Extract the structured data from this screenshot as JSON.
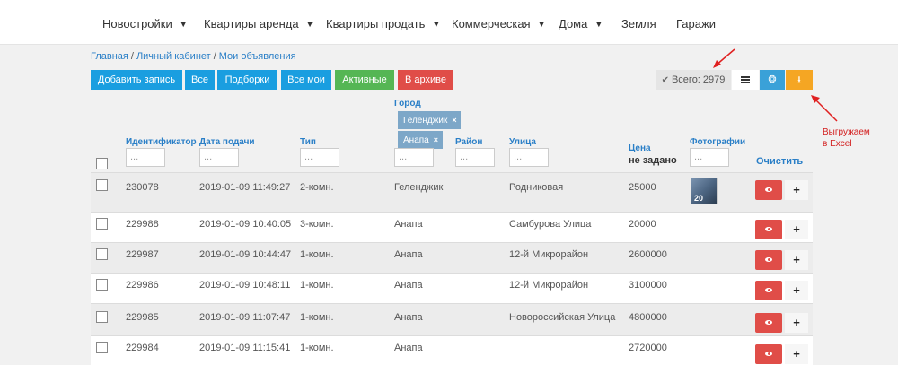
{
  "nav": [
    {
      "label": "Новостройки",
      "dropdown": true
    },
    {
      "label": "Квартиры аренда",
      "dropdown": true
    },
    {
      "label": "Квартиры продать",
      "dropdown": true
    },
    {
      "label": "Коммерческая",
      "dropdown": true
    },
    {
      "label": "Дома",
      "dropdown": true
    },
    {
      "label": "Земля",
      "dropdown": false
    },
    {
      "label": "Гаражи",
      "dropdown": false
    }
  ],
  "breadcrumb": [
    "Главная",
    "Личный кабинет",
    "Мои объявления"
  ],
  "toolbar": {
    "add": "Добавить запись",
    "all": "Все",
    "collections": "Подборки",
    "all_mine": "Все мои",
    "active": "Активные",
    "archive": "В архиве"
  },
  "total_label": "Всего: 2979",
  "annotation": [
    "Выгружаем",
    "в Excel"
  ],
  "filters": {
    "city_label": "Город",
    "city_chips": [
      "Геленджик",
      "Анапа"
    ],
    "id_label": "Идентификатор",
    "date_label": "Дата подачи",
    "type_label": "Тип",
    "district_label": "Район",
    "street_label": "Улица",
    "price_label": "Цена",
    "price_sort": "не задано",
    "photos_label": "Фотографии",
    "clear": "Очистить",
    "placeholder": "..."
  },
  "rows": [
    {
      "id": "230078",
      "date": "2019-01-09 11:49:27",
      "type": "2-комн.",
      "city": "Геленджик",
      "street": "Родниковая",
      "price": "25000",
      "photos": "20"
    },
    {
      "id": "229988",
      "date": "2019-01-09 10:40:05",
      "type": "3-комн.",
      "city": "Анапа",
      "street": "Самбурова Улица",
      "price": "20000",
      "photos": ""
    },
    {
      "id": "229987",
      "date": "2019-01-09 10:44:47",
      "type": "1-комн.",
      "city": "Анапа",
      "street": "12-й Микрорайон",
      "price": "2600000",
      "photos": ""
    },
    {
      "id": "229986",
      "date": "2019-01-09 10:48:11",
      "type": "1-комн.",
      "city": "Анапа",
      "street": "12-й Микрорайон",
      "price": "3100000",
      "photos": ""
    },
    {
      "id": "229985",
      "date": "2019-01-09 11:07:47",
      "type": "1-комн.",
      "city": "Анапа",
      "street": "Новороссийская Улица",
      "price": "4800000",
      "photos": ""
    },
    {
      "id": "229984",
      "date": "2019-01-09 11:15:41",
      "type": "1-комн.",
      "city": "Анапа",
      "street": "",
      "price": "2720000",
      "photos": ""
    }
  ],
  "colors": {
    "primary": "#1a9ee0",
    "success": "#55b654",
    "danger": "#e04d48",
    "warning": "#f5a623",
    "link": "#2a7fc7"
  }
}
